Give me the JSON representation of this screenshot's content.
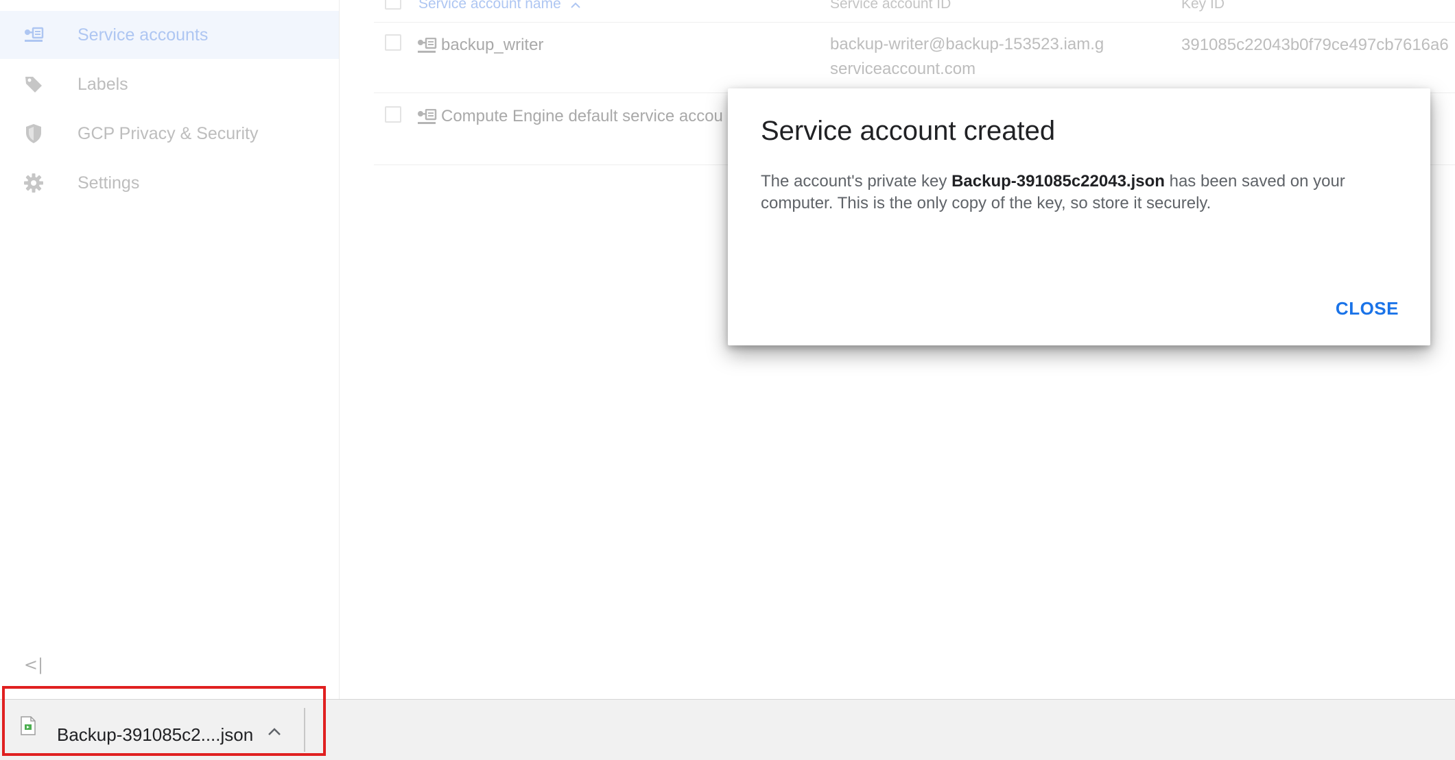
{
  "sidebar": {
    "items": [
      {
        "label": "Service accounts",
        "icon": "service-account-icon",
        "active": true
      },
      {
        "label": "Labels",
        "icon": "label-tag-icon",
        "active": false
      },
      {
        "label": "GCP Privacy & Security",
        "icon": "shield-icon",
        "active": false
      },
      {
        "label": "Settings",
        "icon": "gear-icon",
        "active": false
      }
    ],
    "collapse_glyph": "<|"
  },
  "table": {
    "headers": {
      "name": "Service account name",
      "id": "Service account ID",
      "key": "Key ID"
    },
    "rows": [
      {
        "name": "backup_writer",
        "id": "backup-writer@backup-153523.iam.gserviceaccount.com",
        "key": "391085c22043b0f79ce497cb7616a6"
      },
      {
        "name": "Compute Engine default service accou",
        "id": "",
        "key": ""
      }
    ]
  },
  "dialog": {
    "title": "Service account created",
    "body_prefix": "The account's private key ",
    "filename": "Backup-391085c22043.json",
    "body_suffix": " has been saved on your computer. This is the only copy of the key, so store it securely.",
    "close_label": "CLOSE"
  },
  "download_shelf": {
    "file_name": "Backup-391085c2....json",
    "file_icon": "json-file-icon",
    "expand_icon": "chevron-up-icon"
  },
  "colors": {
    "accent": "#1a73e8",
    "highlight": "#e02020",
    "active_nav_bg": "#f2f6fd"
  }
}
